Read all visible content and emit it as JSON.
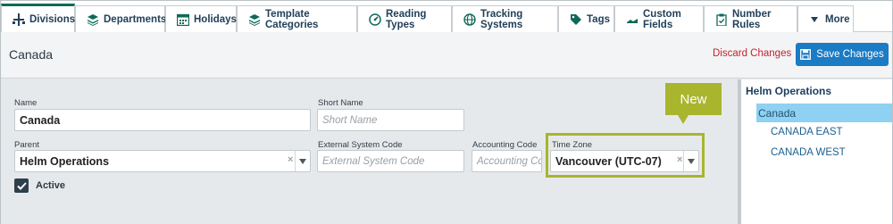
{
  "tabs": [
    {
      "label": "Divisions",
      "icon": "hierarchy-icon",
      "active": true
    },
    {
      "label": "Departments",
      "icon": "layers-icon"
    },
    {
      "label": "Holidays",
      "icon": "calendar-icon"
    },
    {
      "label": "Template Categories",
      "icon": "layers-icon"
    },
    {
      "label": "Reading Types",
      "icon": "gauge-icon"
    },
    {
      "label": "Tracking Systems",
      "icon": "globe-icon"
    },
    {
      "label": "Tags",
      "icon": "tag-icon"
    },
    {
      "label": "Custom Fields",
      "icon": "custom-fields-icon"
    },
    {
      "label": "Number Rules",
      "icon": "clipboard-icon"
    },
    {
      "label": "More",
      "icon": "caret-down-icon"
    }
  ],
  "header": {
    "title": "Canada",
    "discard_label": "Discard Changes",
    "save_label": "Save Changes"
  },
  "form": {
    "name_label": "Name",
    "name_value": "Canada",
    "short_name_label": "Short Name",
    "short_name_placeholder": "Short Name",
    "parent_label": "Parent",
    "parent_value": "Helm Operations",
    "external_code_label": "External System Code",
    "external_code_placeholder": "External System Code",
    "accounting_code_label": "Accounting Code",
    "accounting_code_placeholder": "Accounting Co",
    "time_zone_label": "Time Zone",
    "time_zone_value": "Vancouver (UTC-07)",
    "clear_symbol": "×",
    "active_label": "Active",
    "active_checked": true
  },
  "callout": {
    "text": "New"
  },
  "tree": {
    "root": "Helm Operations",
    "selected": "Canada",
    "children": [
      "CANADA EAST",
      "CANADA WEST"
    ]
  },
  "colors": {
    "accent_green": "#0d6a57",
    "primary_blue": "#1b7bc4",
    "danger_red": "#c42230",
    "callout_olive": "#a9b52d",
    "tree_selected": "#8ed1f2"
  }
}
